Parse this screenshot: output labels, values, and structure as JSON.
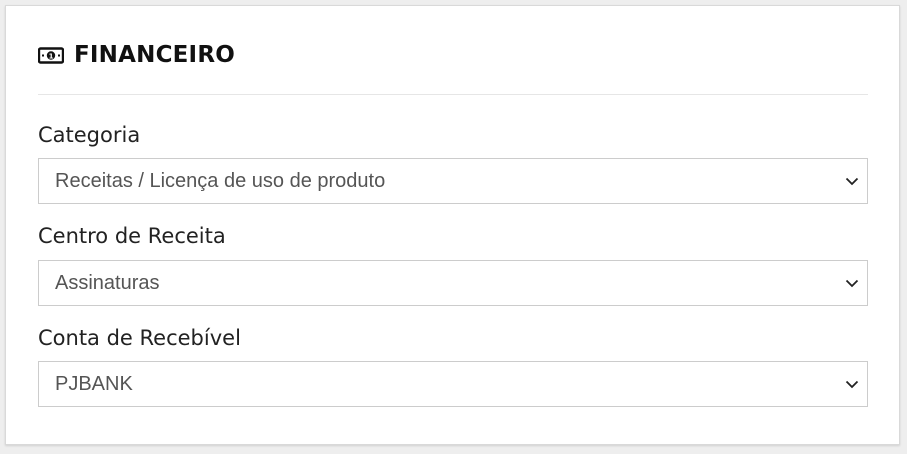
{
  "section": {
    "title": "FINANCEIRO",
    "icon": "money-bill-icon"
  },
  "fields": [
    {
      "label": "Categoria",
      "value": "Receitas / Licença de uso de produto"
    },
    {
      "label": "Centro de Receita",
      "value": "Assinaturas"
    },
    {
      "label": "Conta de Recebível",
      "value": "PJBANK"
    }
  ]
}
